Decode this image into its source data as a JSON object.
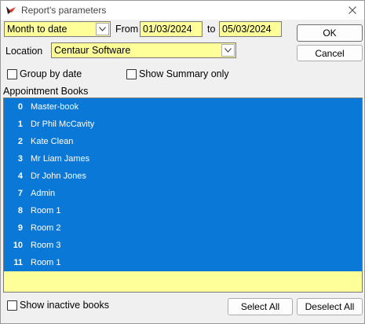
{
  "window": {
    "title": "Report's parameters"
  },
  "period": {
    "selected": "Month to date"
  },
  "from": {
    "label": "From",
    "value": "01/03/2024"
  },
  "to": {
    "label": "to",
    "value": "05/03/2024"
  },
  "buttons": {
    "ok": "OK",
    "cancel": "Cancel",
    "select_all": "Select All",
    "deselect_all": "Deselect All"
  },
  "location": {
    "label": "Location",
    "selected": "Centaur Software"
  },
  "options": {
    "group_by_date": "Group by date",
    "show_summary_only": "Show Summary only",
    "show_inactive_books": "Show inactive books"
  },
  "appointment_books": {
    "label": "Appointment Books",
    "items": [
      {
        "num": "0",
        "name": "Master-book"
      },
      {
        "num": "1",
        "name": "Dr Phil McCavity"
      },
      {
        "num": "2",
        "name": "Kate Clean"
      },
      {
        "num": "3",
        "name": "Mr Liam James"
      },
      {
        "num": "4",
        "name": "Dr John Jones"
      },
      {
        "num": "7",
        "name": "Admin"
      },
      {
        "num": "8",
        "name": "Room 1"
      },
      {
        "num": "9",
        "name": "Room 2"
      },
      {
        "num": "10",
        "name": "Room 3"
      },
      {
        "num": "11",
        "name": "Room 1"
      }
    ]
  },
  "colors": {
    "selection": "#0a78d7",
    "field_background": "#ffff99",
    "dialog_background": "#f0f0f0"
  },
  "icons": {
    "app": "app-logo-icon",
    "close": "close-icon",
    "dropdown": "chevron-down-icon"
  }
}
